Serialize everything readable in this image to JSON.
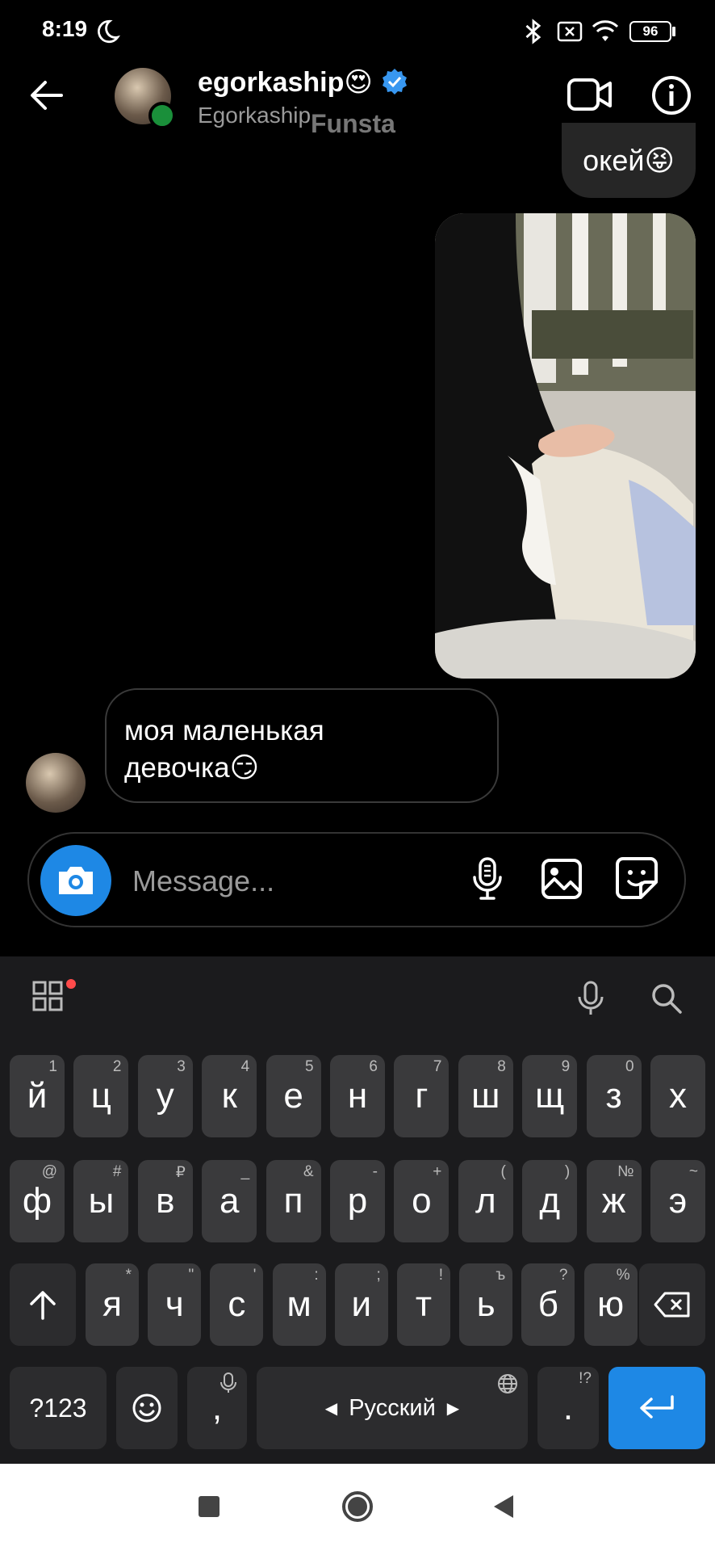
{
  "status_bar": {
    "time": "8:19",
    "battery": "96"
  },
  "header": {
    "username": "egorkaship😍",
    "subtitle": "Egorkaship",
    "overlay_text": "Funsta"
  },
  "messages": {
    "outgoing_text": "окей😝",
    "incoming_line1": "моя маленькая",
    "incoming_line2": "девочка😏"
  },
  "composer": {
    "placeholder": "Message..."
  },
  "keyboard": {
    "row1": [
      {
        "k": "й",
        "h": "1"
      },
      {
        "k": "ц",
        "h": "2"
      },
      {
        "k": "у",
        "h": "3"
      },
      {
        "k": "к",
        "h": "4"
      },
      {
        "k": "е",
        "h": "5"
      },
      {
        "k": "н",
        "h": "6"
      },
      {
        "k": "г",
        "h": "7"
      },
      {
        "k": "ш",
        "h": "8"
      },
      {
        "k": "щ",
        "h": "9"
      },
      {
        "k": "з",
        "h": "0"
      },
      {
        "k": "х",
        "h": ""
      }
    ],
    "row2": [
      {
        "k": "ф",
        "h": "@"
      },
      {
        "k": "ы",
        "h": "#"
      },
      {
        "k": "в",
        "h": "₽"
      },
      {
        "k": "а",
        "h": "_"
      },
      {
        "k": "п",
        "h": "&"
      },
      {
        "k": "р",
        "h": "-"
      },
      {
        "k": "о",
        "h": "+"
      },
      {
        "k": "л",
        "h": "("
      },
      {
        "k": "д",
        "h": ")"
      },
      {
        "k": "ж",
        "h": "№"
      },
      {
        "k": "э",
        "h": "~"
      }
    ],
    "row3": [
      {
        "k": "я",
        "h": "*"
      },
      {
        "k": "ч",
        "h": "\""
      },
      {
        "k": "с",
        "h": "'"
      },
      {
        "k": "м",
        "h": ":"
      },
      {
        "k": "и",
        "h": ";"
      },
      {
        "k": "т",
        "h": "!"
      },
      {
        "k": "ь",
        "h": "ъ"
      },
      {
        "k": "б",
        "h": "?"
      },
      {
        "k": "ю",
        "h": "%"
      }
    ],
    "symbols_label": "?123",
    "comma_label": ",",
    "space_label": "Русский",
    "period_label": ".",
    "period_hint": "!?"
  },
  "colors": {
    "accent": "#1e88e5",
    "notification_dot": "#ff4b4b"
  }
}
